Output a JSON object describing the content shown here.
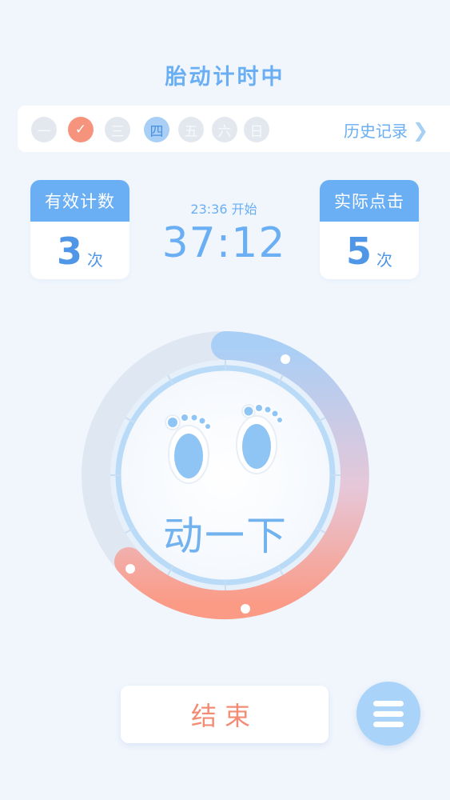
{
  "header": {
    "title": "胎动计时中"
  },
  "week": {
    "days": [
      {
        "label": "一",
        "state": "future"
      },
      {
        "label": "✓",
        "state": "done"
      },
      {
        "label": "三",
        "state": "future"
      },
      {
        "label": "四",
        "state": "today"
      },
      {
        "label": "五",
        "state": "future"
      },
      {
        "label": "六",
        "state": "future"
      },
      {
        "label": "日",
        "state": "future"
      }
    ],
    "history_label": "历史记录",
    "history_arrow": "❯"
  },
  "stats": {
    "valid": {
      "title": "有效计数",
      "value": "3",
      "unit": "次"
    },
    "actual": {
      "title": "实际点击",
      "value": "5",
      "unit": "次"
    }
  },
  "timer": {
    "start_label": "23:36 开始",
    "elapsed": "37:12"
  },
  "dial": {
    "label": "动一下"
  },
  "actions": {
    "end_label": "结束"
  },
  "colors": {
    "accent_blue": "#6aaef3",
    "accent_coral": "#f28c74",
    "background": "#f1f6fd"
  },
  "icons": {
    "check": "check-icon",
    "arrow": "chevron-right-icon",
    "feet": "baby-feet-icon",
    "menu": "menu-icon"
  }
}
